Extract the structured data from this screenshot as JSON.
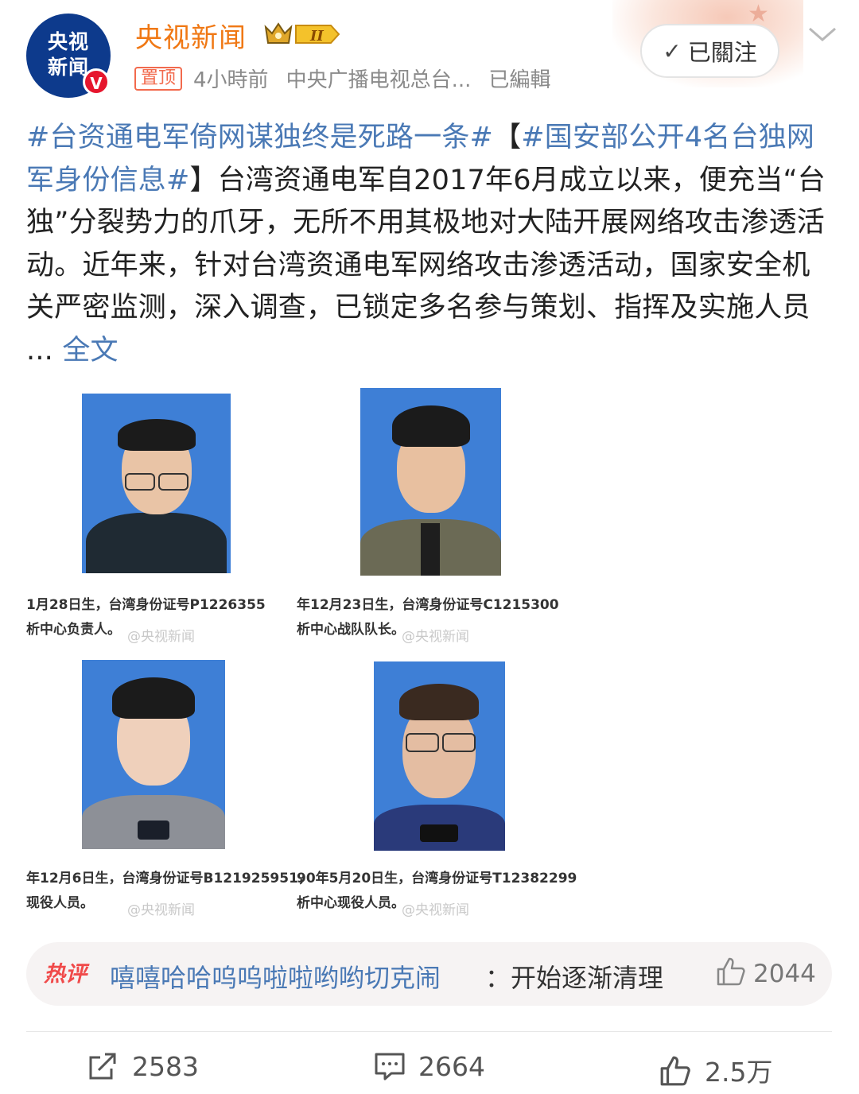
{
  "header": {
    "author": "央视新闻",
    "avatar_text_line1": "央视",
    "avatar_text_line2": "新闻",
    "verified_mark": "V",
    "level_badge": "II",
    "pin_tag": "置顶",
    "time": "4小時前",
    "source": "中央广播电视总台...",
    "edited": "已編輯",
    "follow_label": "已關注"
  },
  "post": {
    "hashtag1": "#台资通电军倚网谋独终是死路一条#",
    "bracket_open": "【",
    "hashtag2": "#国安部公开4名台独网军身份信息#",
    "bracket_close": "】",
    "body": "台湾资通电军自2017年6月成立以来，便充当“台独”分裂势力的爪牙，无所不用其极地对大陆开展网络攻击渗透活动。近年来，针对台湾资通电军网络攻击渗透活动，国家安全机关严密监测，深入调查，已锁定多名参与策划、指挥及实施人员 ... ",
    "more_link": "全文"
  },
  "images": [
    {
      "caption1": "1月28日生，台湾身份证号P1226355",
      "caption2": "析中心负责人。",
      "watermark": "@央视新闻"
    },
    {
      "caption1": "年12月23日生，台湾身份证号C1215300",
      "caption2": "析中心战队队长。",
      "watermark": "@央视新闻"
    },
    {
      "caption1": "年12月6日生，台湾身份证号B121925951，",
      "caption2": "现役人员。",
      "watermark": "@央视新闻"
    },
    {
      "caption1": "90年5月20日生，台湾身份证号T12382299",
      "caption2": "析中心现役人员。",
      "watermark": "@央视新闻"
    }
  ],
  "hot_comment": {
    "label": "热评",
    "user": "嘻嘻哈哈呜呜啦啦哟哟切克闹",
    "text": "：开始逐渐清理",
    "likes": "2044"
  },
  "actions": {
    "repost_count": "2583",
    "comment_count": "2664",
    "like_count": "2.5万"
  },
  "colors": {
    "accent_orange": "#f07814",
    "link_blue": "#4a79b5",
    "photo_blue": "#3e7fd6",
    "verified_red": "#e6162d"
  }
}
